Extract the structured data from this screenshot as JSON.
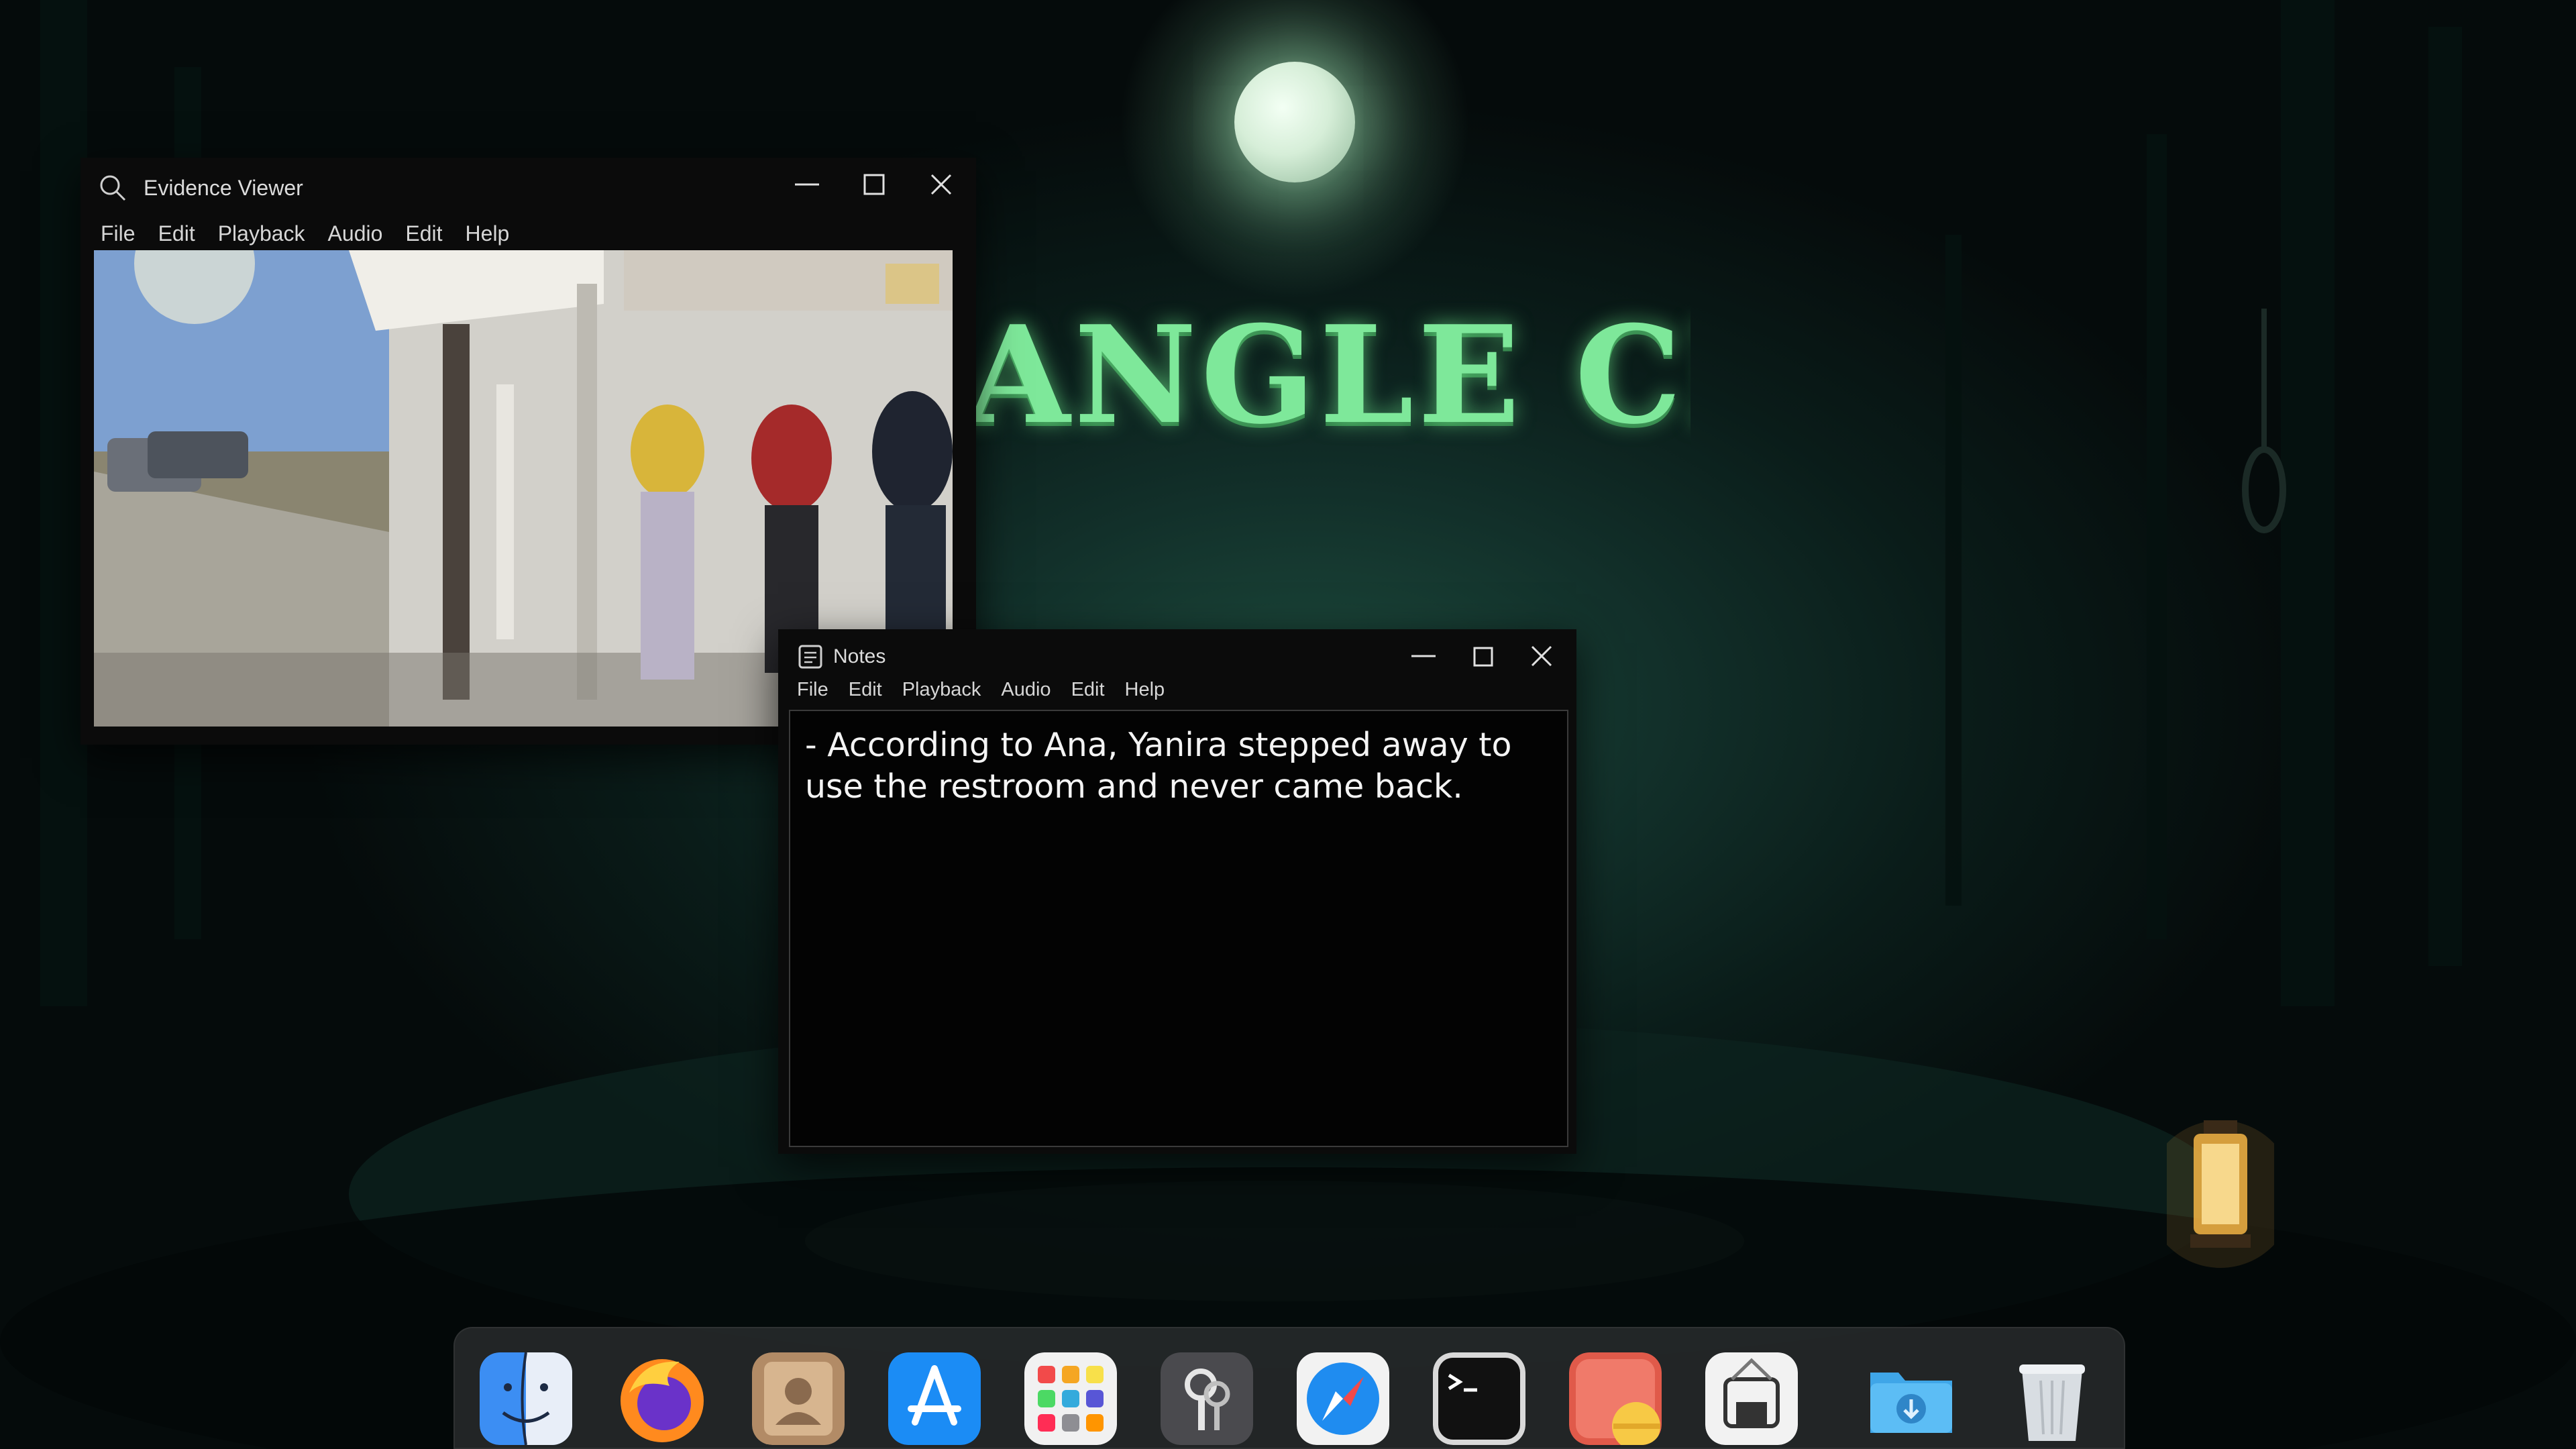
{
  "wallpaper": {
    "title_text": "ANGLE CRIME",
    "colors": {
      "accent": "#7ee89a",
      "background": "#0a1c19"
    }
  },
  "evidence_viewer": {
    "title": "Evidence Viewer",
    "menu": [
      "File",
      "Edit",
      "Playback",
      "Audio",
      "Edit",
      "Help"
    ],
    "icons": {
      "title_icon": "search-icon",
      "minimize": "minimize-icon",
      "maximize": "maximize-icon",
      "close": "close-icon"
    }
  },
  "notes": {
    "title": "Notes",
    "menu": [
      "File",
      "Edit",
      "Playback",
      "Audio",
      "Edit",
      "Help"
    ],
    "content": "- According to Ana, Yanira stepped away to use the restroom and never came back.",
    "icons": {
      "title_icon": "notes-icon",
      "minimize": "minimize-icon",
      "maximize": "maximize-icon",
      "close": "close-icon"
    }
  },
  "dock": {
    "items": [
      {
        "name": "finder-icon"
      },
      {
        "name": "firefox-icon"
      },
      {
        "name": "contacts-icon"
      },
      {
        "name": "app-store-icon"
      },
      {
        "name": "launchpad-icon"
      },
      {
        "name": "keychain-access-icon"
      },
      {
        "name": "safari-icon"
      },
      {
        "name": "terminal-icon"
      },
      {
        "name": "image-viewer-icon"
      },
      {
        "name": "system-information-icon"
      },
      {
        "name": "downloads-folder-icon"
      },
      {
        "name": "trash-icon"
      }
    ]
  }
}
